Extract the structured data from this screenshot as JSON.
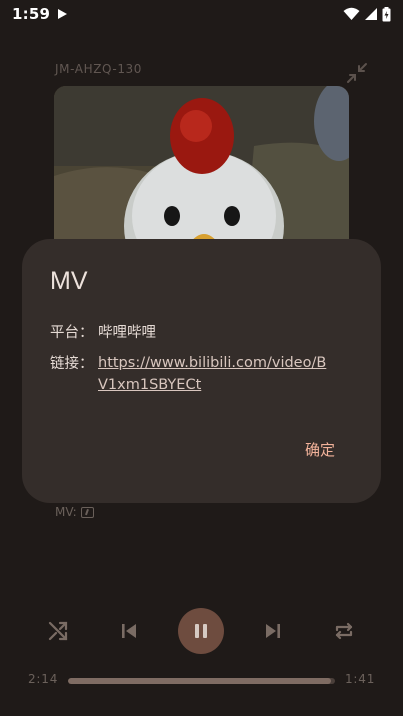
{
  "status_bar": {
    "time": "1:59",
    "icons": [
      "play-indicator-icon",
      "wifi-icon",
      "signal-icon",
      "battery-icon"
    ]
  },
  "player": {
    "track_code": "JM-AHZQ-130",
    "mv_caption": "MV:",
    "time_current": "2:14",
    "time_total": "1:41",
    "progress_fraction": 0.985,
    "controls": [
      "shuffle-icon",
      "skip-previous-icon",
      "pause-icon",
      "skip-next-icon",
      "repeat-icon"
    ]
  },
  "dialog": {
    "title": "MV",
    "platform_label": "平台：",
    "platform_value": "哔哩哔哩",
    "link_label": "链接：",
    "link_value": "https://www.bilibili.com/video/BV1xm1SBYECt",
    "confirm_label": "确定"
  },
  "colors": {
    "background": "#1f1a18",
    "dialog_surface": "#342d2a",
    "accent": "#f2b29a",
    "play_button": "#6e4c3f"
  }
}
